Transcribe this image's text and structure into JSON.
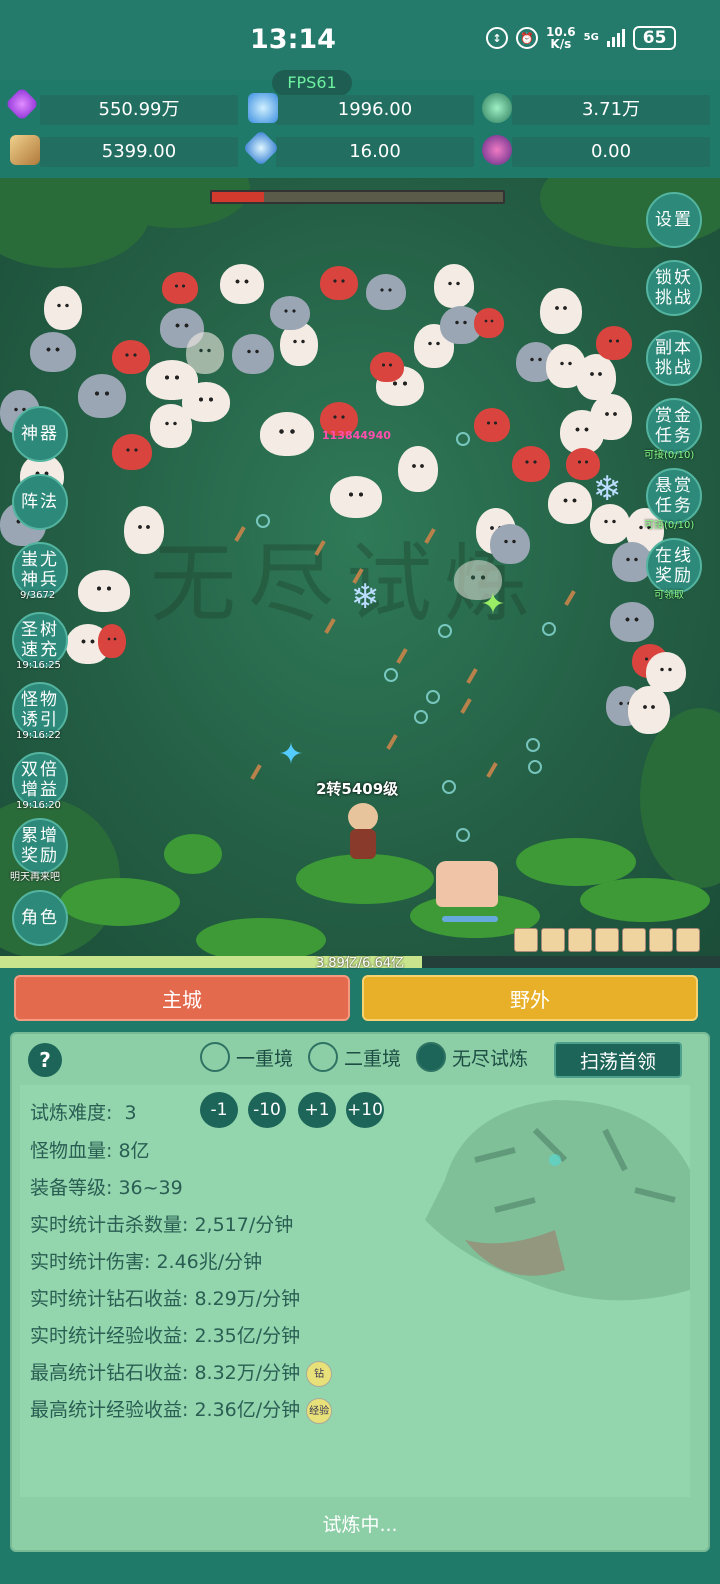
{
  "status_bar": {
    "time": "13:14",
    "net_speed_value": "10.6",
    "net_speed_unit": "K/s",
    "network": "5G",
    "battery": "65"
  },
  "fps": "FPS61",
  "resources": [
    {
      "icon": "purple-gem-icon",
      "value": "550.99万"
    },
    {
      "icon": "blue-diamond-icon",
      "value": "1996.00"
    },
    {
      "icon": "green-orb-icon",
      "value": "3.71万"
    },
    {
      "icon": "scroll-icon",
      "value": "5399.00"
    },
    {
      "icon": "ice-crystal-icon",
      "value": "16.00"
    },
    {
      "icon": "purple-potion-icon",
      "value": "0.00"
    }
  ],
  "game": {
    "damage_number": "113844940",
    "player_label": "2转5409级",
    "exp_text": "3.89亿/6.64亿",
    "exp_fraction": 0.586,
    "boss_hp_fraction": 0.18,
    "watermark_text": "无尽试炼"
  },
  "left_buttons": [
    {
      "label": "神器",
      "sub": ""
    },
    {
      "label": "阵法",
      "sub": ""
    },
    {
      "label": "蚩尤神兵",
      "sub": "9/3672"
    },
    {
      "label": "圣树速充",
      "sub": "19:16:25"
    },
    {
      "label": "怪物诱引",
      "sub": "19:16:22"
    },
    {
      "label": "双倍增益",
      "sub": "19:16:20"
    },
    {
      "label": "累增奖励",
      "sub": "明天再来吧"
    },
    {
      "label": "角色",
      "sub": ""
    }
  ],
  "right_buttons": [
    {
      "label": "设置",
      "sub": ""
    },
    {
      "label": "锁妖挑战",
      "sub": ""
    },
    {
      "label": "副本挑战",
      "sub": ""
    },
    {
      "label": "赏金任务",
      "sub": "可接(0/10)"
    },
    {
      "label": "悬赏任务",
      "sub": "可接(0/10)"
    },
    {
      "label": "在线奖励",
      "sub": "可领取"
    }
  ],
  "tabs": {
    "main_city": "主城",
    "wild": "野外"
  },
  "panel": {
    "help": "?",
    "modes": [
      "一重境",
      "二重境",
      "无尽试炼"
    ],
    "selected_mode": "无尽试炼",
    "sweep_button": "扫荡首领",
    "difficulty_label": "试炼难度:",
    "difficulty_value": "3",
    "difficulty_buttons": [
      "-1",
      "-10",
      "+1",
      "+10"
    ],
    "stats": [
      "怪物血量:  8亿",
      "装备等级:  36~39",
      "实时统计击杀数量:  2,517/分钟",
      "实时统计伤害:  2.46兆/分钟",
      "实时统计钻石收益:  8.29万/分钟",
      "实时统计经验收益:  2.35亿/分钟",
      "最高统计钻石收益:  8.32万/分钟",
      "最高统计经验收益:  2.36亿/分钟"
    ],
    "badge_diamond": "钻",
    "badge_exp": "经验",
    "status": "试炼中..."
  }
}
